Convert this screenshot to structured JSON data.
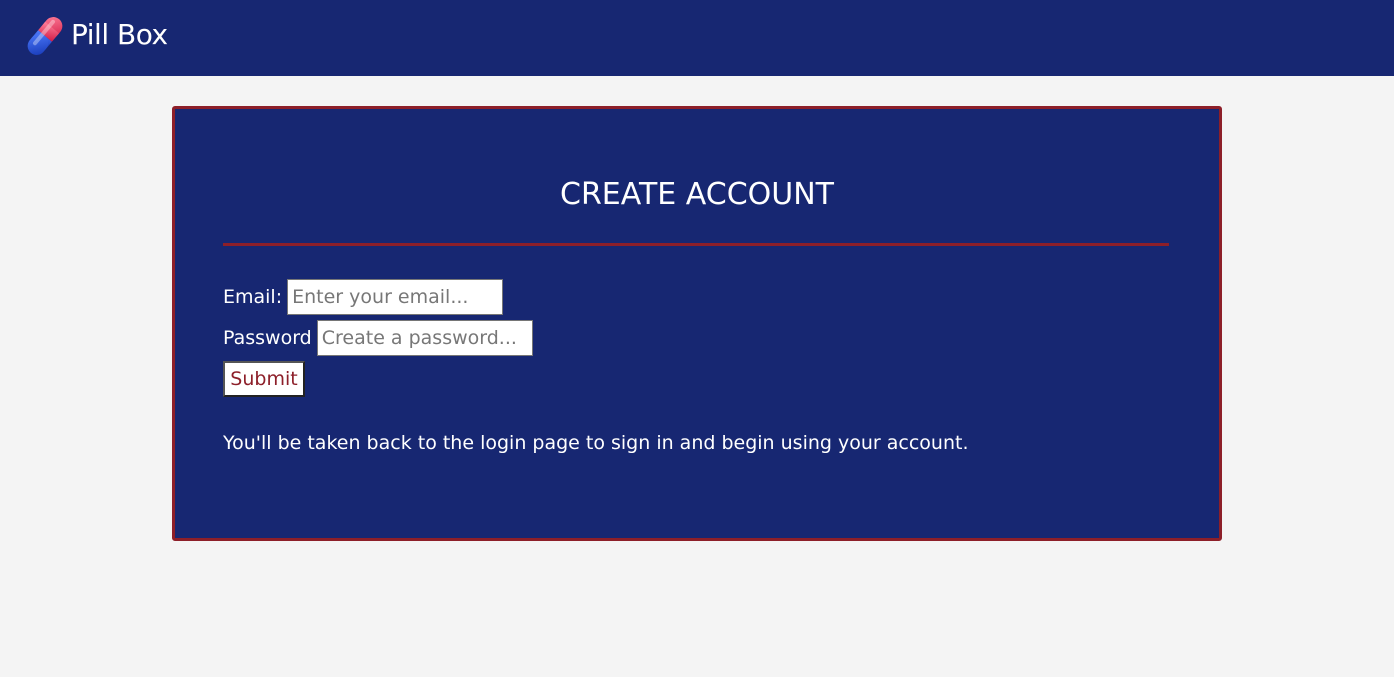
{
  "header": {
    "brand": "Pill Box",
    "logo_icon": "pill-capsule-icon",
    "background_color": "#172772"
  },
  "form": {
    "title": "CREATE ACCOUNT",
    "email_label": "Email:",
    "email_placeholder": "Enter your email...",
    "email_value": "",
    "password_label": "Password",
    "password_placeholder": "Create a password...",
    "password_value": "",
    "submit_label": "Submit",
    "note": "You'll be taken back to the login page to sign in and begin using your account."
  },
  "colors": {
    "primary": "#172772",
    "accent": "#8d1f29",
    "page_background": "#f4f4f4"
  }
}
